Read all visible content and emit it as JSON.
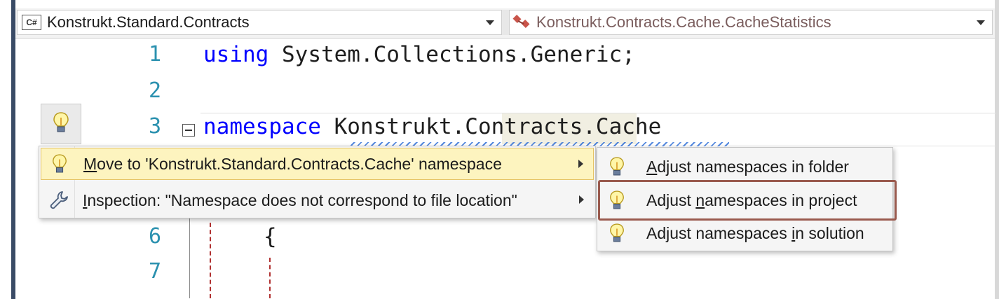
{
  "navbar": {
    "project_combo": {
      "icon": "csharp-file-icon",
      "icon_text": "C#",
      "value": "Konstrukt.Standard.Contracts"
    },
    "type_combo": {
      "icon": "class-icon",
      "value": "Konstrukt.Contracts.Cache.CacheStatistics"
    }
  },
  "editor": {
    "lines": [
      {
        "number": "1",
        "keyword": "using",
        "text": " System.Collections.Generic;"
      },
      {
        "number": "2",
        "keyword": "",
        "text": ""
      },
      {
        "number": "3",
        "keyword": "namespace",
        "text": " Konstrukt.Contracts.Cache"
      },
      {
        "number": "6",
        "keyword": "",
        "text": "{"
      },
      {
        "number": "7",
        "keyword": "",
        "text": ""
      }
    ],
    "gutter_icon": "lightbulb-icon"
  },
  "context_menu": {
    "items": [
      {
        "icon": "lightbulb-icon",
        "mnemonic": "M",
        "label_rest": "ove to 'Konstrukt.Standard.Contracts.Cache' namespace",
        "highlighted": true
      },
      {
        "icon": "wrench-icon",
        "mnemonic": "I",
        "label_rest": "nspection: \"Namespace does not correspond to file location\"",
        "highlighted": false
      }
    ]
  },
  "submenu": {
    "items": [
      {
        "icon": "lightbulb-icon",
        "before": "",
        "mnemonic": "A",
        "after": "djust namespaces in folder"
      },
      {
        "icon": "lightbulb-icon",
        "before": "Adjust ",
        "mnemonic": "n",
        "after": "amespaces in project"
      },
      {
        "icon": "lightbulb-icon",
        "before": "Adjust namespaces ",
        "mnemonic": "i",
        "after": "n solution"
      }
    ],
    "selected_index": 1
  },
  "colors": {
    "keyword": "#0000ff",
    "line_number": "#2b91af",
    "menu_highlight": "#fdf4bf",
    "selection_border": "#9a5a4e"
  }
}
